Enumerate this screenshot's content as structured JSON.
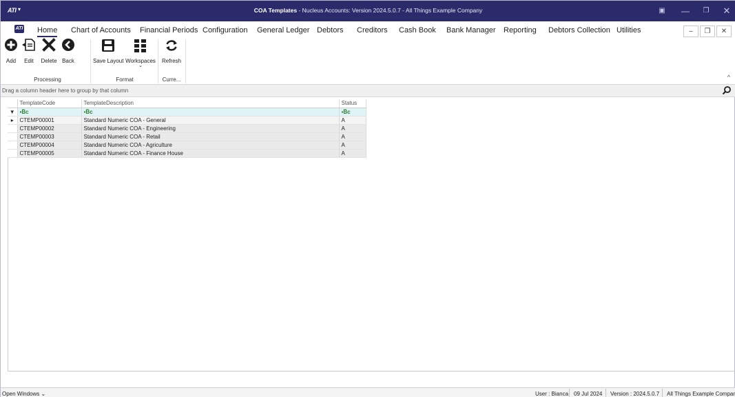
{
  "window": {
    "app_logo": "ATI",
    "title_bold": "COA Templates",
    "title_rest": " - Nucleus Accounts: Version 2024.5.0.7 - All Things Example Company",
    "controls": {
      "minimize": "—",
      "maximize": "❐",
      "close": "✕"
    }
  },
  "menu": {
    "tabs": [
      "Home",
      "Chart of Accounts",
      "Financial Periods",
      "Configuration",
      "General Ledger",
      "Debtors",
      "Creditors",
      "Cash Book",
      "Bank Manager",
      "Reporting",
      "Debtors Collection",
      "Utilities"
    ],
    "active_tab": "Home",
    "mdi_controls": {
      "minimize": "–",
      "restore": "❐",
      "close": "✕"
    }
  },
  "ribbon": {
    "groups": [
      {
        "label": "Processing",
        "buttons": [
          "Add",
          "Edit",
          "Delete",
          "Back"
        ]
      },
      {
        "label": "Format",
        "buttons": [
          "Save Layout",
          "Workspaces"
        ]
      },
      {
        "label": "Curre...",
        "buttons": [
          "Refresh"
        ]
      }
    ],
    "icons": {
      "add": "plus-circle-icon",
      "edit": "edit-document-icon",
      "delete": "x-icon",
      "back": "back-circle-icon",
      "save_layout": "save-layout-icon",
      "workspaces": "grid-icon",
      "refresh": "refresh-icon"
    }
  },
  "group_panel": {
    "hint": "Drag a column header here to group by that column"
  },
  "grid": {
    "columns": [
      "TemplateCode",
      "TemplateDescription",
      "Status"
    ],
    "filter_symbol": "▪B̅c",
    "rows": [
      [
        "CTEMP00001",
        "Standard Numeric COA - General",
        "A"
      ],
      [
        "CTEMP00002",
        "Standard Numeric COA - Engineering",
        "A"
      ],
      [
        "CTEMP00003",
        "Standard Numeric COA - Retail",
        "A"
      ],
      [
        "CTEMP00004",
        "Standard Numeric COA - Agriculture",
        "A"
      ],
      [
        "CTEMP00005",
        "Standard Numeric COA - Finance House",
        "A"
      ]
    ]
  },
  "status_bar": {
    "open_windows": "Open Windows ⌄",
    "user": "User : Bianca",
    "date": "09 Jul 2024",
    "version": "Version : 2024.5.0.7",
    "company": "All Things Example Company"
  },
  "colors": {
    "title_bar": "#2b2a6b",
    "filter_row": "#dff4f7",
    "row_bg": "#eaeaea"
  }
}
